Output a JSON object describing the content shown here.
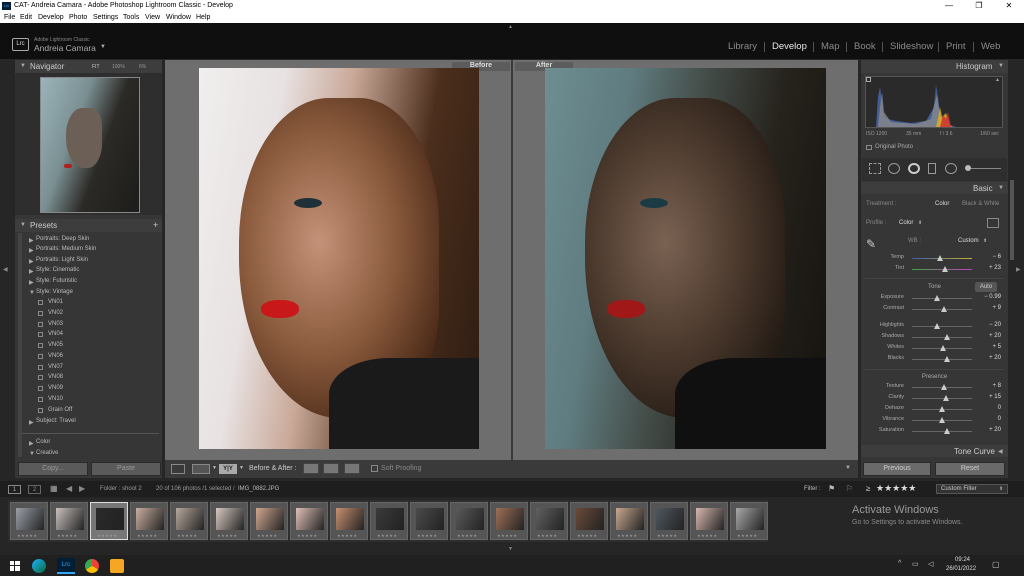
{
  "window": {
    "title": "CAT- Andreia Camara - Adobe Photoshop Lightroom Classic - Develop",
    "app_icon": "Lrc"
  },
  "menu": [
    "File",
    "Edit",
    "Develop",
    "Photo",
    "Settings",
    "Tools",
    "View",
    "Window",
    "Help"
  ],
  "identity": {
    "product": "Adobe Lightroom Classic",
    "user": "Andreia Camara",
    "logo": "Lrc"
  },
  "modules": [
    "Library",
    "Develop",
    "Map",
    "Book",
    "Slideshow",
    "Print",
    "Web"
  ],
  "active_module": "Develop",
  "navigator": {
    "title": "Navigator",
    "fit": "FIT",
    "z1": "100%",
    "z2": "6%"
  },
  "presets": {
    "title": "Presets",
    "items": [
      "Portraits: Deep Skin",
      "Portraits: Medium Skin",
      "Portraits: Light Skin",
      "Style: Cinematic",
      "Style: Futuristic",
      "Style: Vintage"
    ],
    "vintage_children": [
      "VN01",
      "VN02",
      "VN03",
      "VN04",
      "VN05",
      "VN06",
      "VN07",
      "VN08",
      "VN09",
      "VN10",
      "Grain Off"
    ],
    "after": [
      "Subject: Travel"
    ],
    "groups": [
      "Color",
      "Creative"
    ]
  },
  "left_buttons": {
    "copy": "Copy...",
    "paste": "Paste"
  },
  "compare": {
    "before": "Before",
    "after": "After"
  },
  "toolbar": {
    "before_after_label": "Before & After :",
    "soft_proofing": "Soft Proofing",
    "yy": "Y|Y"
  },
  "histogram": {
    "title": "Histogram",
    "iso": "ISO 1200",
    "focal": "35 mm",
    "aperture": "f / 3.6",
    "shutter": "1/60 sec",
    "original_photo": "Original Photo"
  },
  "basic": {
    "title": "Basic",
    "treatment_label": "Treatment :",
    "treatment_color": "Color",
    "treatment_bw": "Black & White",
    "profile_label": "Profile :",
    "profile_value": "Color",
    "wb_label": "WB :",
    "wb_value": "Custom",
    "tone_label": "Tone",
    "auto_label": "Auto",
    "presence_label": "Presence",
    "wb_sliders": [
      {
        "label": "Temp",
        "value": "− 6",
        "pos": 0.47
      },
      {
        "label": "Tint",
        "value": "+ 23",
        "pos": 0.55
      }
    ],
    "tone_sliders": [
      {
        "label": "Exposure",
        "value": "− 0.99",
        "pos": 0.42
      },
      {
        "label": "Contrast",
        "value": "+ 9",
        "pos": 0.53
      }
    ],
    "tone_sliders2": [
      {
        "label": "Highlights",
        "value": "− 20",
        "pos": 0.42
      },
      {
        "label": "Shadows",
        "value": "+ 20",
        "pos": 0.58
      },
      {
        "label": "Whites",
        "value": "+ 5",
        "pos": 0.52
      },
      {
        "label": "Blacks",
        "value": "+ 20",
        "pos": 0.58
      }
    ],
    "presence_sliders": [
      {
        "label": "Texture",
        "value": "+ 8",
        "pos": 0.54
      },
      {
        "label": "Clarity",
        "value": "+ 15",
        "pos": 0.57
      },
      {
        "label": "Dehaze",
        "value": "0",
        "pos": 0.5
      },
      {
        "label": "Vibrance",
        "value": "0",
        "pos": 0.5
      },
      {
        "label": "Saturation",
        "value": "+ 20",
        "pos": 0.58
      }
    ]
  },
  "tone_curve": {
    "title": "Tone Curve"
  },
  "right_buttons": {
    "previous": "Previous",
    "reset": "Reset"
  },
  "filmstrip": {
    "folder": "Folder : shoot 2",
    "count": "20 of 106 photos /1 selected /",
    "file": "IMG_0882.JPG",
    "filter_label": "Filter :",
    "rating_op": "≥",
    "stars": "★★★★★",
    "custom_filter": "Custom Filter",
    "thumb_count": 19,
    "stars_small": "★★★★★"
  },
  "activate": {
    "title": "Activate Windows",
    "subtitle": "Go to Settings to activate Windows."
  },
  "taskbar": {
    "time": "09:24",
    "date": "26/01/2022"
  }
}
